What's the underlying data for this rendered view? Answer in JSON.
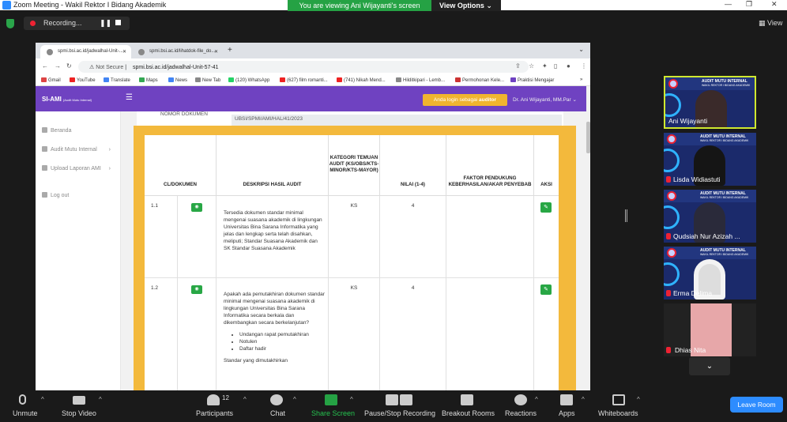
{
  "window": {
    "title": "Zoom Meeting - Wakil Rektor I Bidang Akademik"
  },
  "share": {
    "message": "You are viewing Ani Wijayanti's screen",
    "options": "View Options"
  },
  "recording": {
    "label": "Recording..."
  },
  "view_label": "View",
  "browser": {
    "tabs": [
      {
        "label": "spmi.bsi.ac.id/jadwalhal-Unit-..."
      },
      {
        "label": "spmi.bsi.ac.id/lihatdok-file_do..."
      }
    ],
    "not_secure": "Not Secure",
    "url": "spmi.bsi.ac.id/jadwalhal-Unit-57-41",
    "bookmarks": [
      "Gmail",
      "YouTube",
      "Translate",
      "Maps",
      "News",
      "New Tab",
      "(120) WhatsApp",
      "(627) film romanti...",
      "(741) Nikah Mend...",
      "Hilditkipari - Lemb...",
      "Permohonan Kele...",
      "Praktisi Mengajar"
    ]
  },
  "app": {
    "brand": "SI-AMI",
    "brand_sub": "(Audit Mutu Internal)",
    "login_prefix": "Anda login sebagai ",
    "login_role": "auditor",
    "user": "Dr. Ani Wijayanti, MM.Par",
    "sidebar": [
      {
        "label": "Beranda"
      },
      {
        "label": "Audit Mutu Internal"
      },
      {
        "label": "Upload Laporan AMI"
      },
      {
        "label": "Log out"
      }
    ],
    "nomor_label": "NOMOR DOKUMEN",
    "nomor_value": "UBSI/SPMI/AMI/HAL/41/2023",
    "table": {
      "headers": [
        "CL/DOKUMEN",
        "DESKRIPSI HASIL AUDIT",
        "KATEGORI TEMUAN AUDIT (KS/OBS/KTS-MINOR/KTS-MAYOR)",
        "NILAI (1-4)",
        "FAKTOR PENDUKUNG KEBERHASILAN/AKAR PENYEBAB",
        "AKSI"
      ],
      "rows": [
        {
          "no": "1.1",
          "desc": "Tersedia dokumen standar minimal mengenai suasana akademik di lingkungan Universitas Bina Sarana Informatika yang jelas dan lengkap serta telah disahkan, meliputi; Standar Suasana Akademik dan SK Standar Suasana Akademik",
          "kategori": "KS",
          "nilai": "4"
        },
        {
          "no": "1.2",
          "desc": "Apakah ada pemutakhiran dokumen standar minimal mengenai suasana akademik di lingkungan Universitas Bina Sarana Informatika secara berkala dan dikembangkan secara berkelanjutan?",
          "bullets": [
            "Undangan rapat pemutakhiran",
            "Notulen",
            "Daftar hadir"
          ],
          "desc_tail": "Standar  yang dimutakhirkan",
          "kategori": "KS",
          "nilai": "4"
        }
      ]
    }
  },
  "participants_gallery": [
    {
      "name": "Ani Wijayanti",
      "muted": false
    },
    {
      "name": "Lisda Widiastuti",
      "muted": true
    },
    {
      "name": "Qudsiah Nur Azizah ...",
      "muted": true
    },
    {
      "name": "Erma Delima",
      "muted": true
    },
    {
      "name": "Dhias Nita",
      "muted": true
    }
  ],
  "gallery_banner": {
    "t1": "AUDIT MUTU INTERNAL",
    "t2": "WAKIL REKTOR I BIDANG AKADEMIK"
  },
  "toolbar": {
    "unmute": "Unmute",
    "stop_video": "Stop Video",
    "participants": "Participants",
    "participants_count": "12",
    "chat": "Chat",
    "share_screen": "Share Screen",
    "pause_stop": "Pause/Stop Recording",
    "breakout": "Breakout Rooms",
    "reactions": "Reactions",
    "apps": "Apps",
    "whiteboards": "Whiteboards",
    "leave": "Leave Room"
  },
  "colors": {
    "brand_purple": "#6f42c1",
    "zoom_blue": "#2d8cff",
    "share_green": "#25a244",
    "card_yellow": "#f3b93c",
    "action_green": "#28a745"
  }
}
